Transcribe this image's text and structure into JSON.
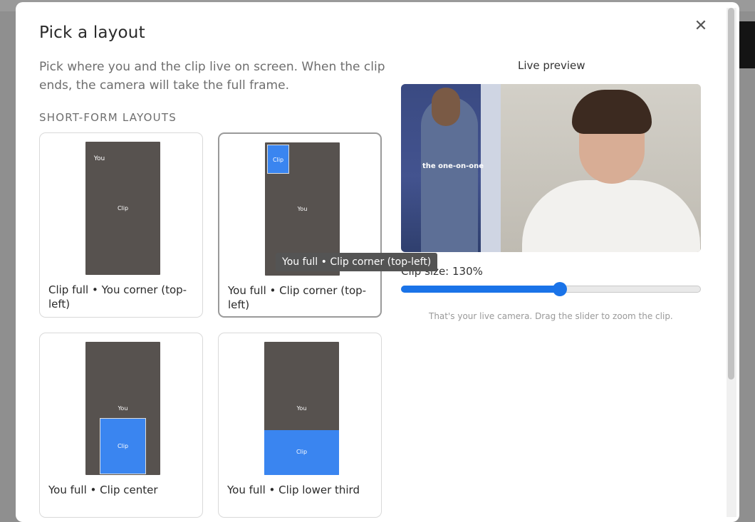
{
  "modal": {
    "title": "Pick a layout",
    "description": "Pick where you and the clip live on screen. When the clip ends, the camera will take the full frame.",
    "section_label": "SHORT-FORM LAYOUTS",
    "close_icon": "close-icon"
  },
  "layouts": [
    {
      "caption": "Clip full • You corner (top-left)",
      "label_a": "You",
      "label_b": "Clip",
      "selected": false
    },
    {
      "caption": "You full • Clip corner (top-left)",
      "label_a": "Clip",
      "label_b": "You",
      "selected": true
    },
    {
      "caption": "You full • Clip center",
      "label_a": "You",
      "label_b": "Clip",
      "selected": false
    },
    {
      "caption": "You full • Clip lower third",
      "label_a": "You",
      "label_b": "Clip",
      "selected": false
    }
  ],
  "tooltip": "You full • Clip corner (top-left)",
  "preview": {
    "label": "Live preview",
    "overlay_text": "the one-on-one"
  },
  "slider": {
    "label": "Clip size: 130%",
    "fraction": 0.53,
    "hint": "That's your live camera. Drag the slider to zoom the clip."
  },
  "colors": {
    "clip_blue": "#3a85f0",
    "you_gray": "#57524f",
    "slider_blue": "#1a73e8"
  }
}
